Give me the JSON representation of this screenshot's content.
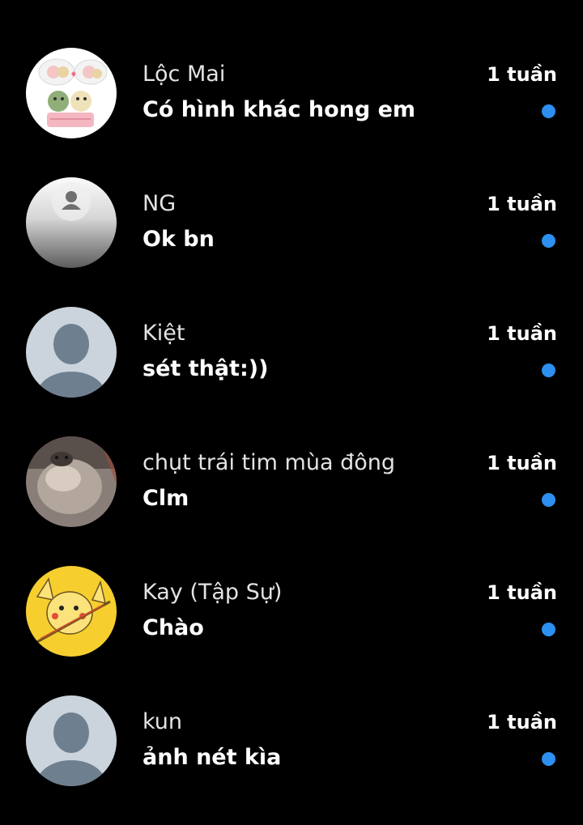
{
  "theme": {
    "unread_color": "#2d8ff0",
    "background": "#000000"
  },
  "conversations": [
    {
      "name": "Lộc Mai",
      "message": "Có hình khác hong em",
      "time": "1 tuần",
      "unread": true,
      "avatar": "sticker-bears-avatar"
    },
    {
      "name": "NG",
      "message": "Ok bn",
      "time": "1 tuần",
      "unread": true,
      "avatar": "gray-gradient-avatar"
    },
    {
      "name": "Kiệt",
      "message": "sét thật:))",
      "time": "1 tuần",
      "unread": true,
      "avatar": "default-user-avatar"
    },
    {
      "name": "chụt trái tim mùa đông",
      "message": "Clm",
      "time": "1 tuần",
      "unread": true,
      "avatar": "hamster-photo-avatar"
    },
    {
      "name": "Kay (Tập Sự)",
      "message": "Chào",
      "time": "1 tuần",
      "unread": true,
      "avatar": "pikachu-sword-avatar"
    },
    {
      "name": "kun",
      "message": "ảnh nét kìa",
      "time": "1 tuần",
      "unread": true,
      "avatar": "default-user-avatar"
    }
  ]
}
